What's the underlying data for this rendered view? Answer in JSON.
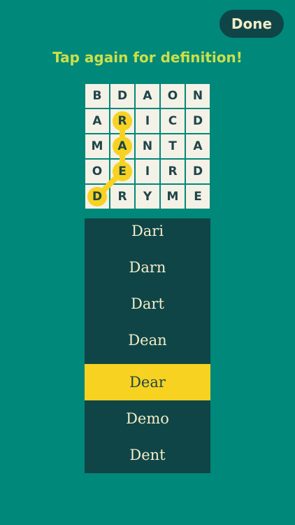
{
  "header": {
    "done_label": "Done",
    "instruction": "Tap again for definition!"
  },
  "colors": {
    "background": "#00887a",
    "dark": "#0f4547",
    "highlight": "#f7d221",
    "instruction_text": "#cbe049",
    "cell_bg": "#f4f1e6"
  },
  "grid": {
    "rows": [
      [
        "B",
        "D",
        "A",
        "O",
        "N"
      ],
      [
        "A",
        "R",
        "I",
        "C",
        "D"
      ],
      [
        "M",
        "A",
        "N",
        "T",
        "A"
      ],
      [
        "O",
        "E",
        "I",
        "R",
        "D"
      ],
      [
        "D",
        "R",
        "Y",
        "M",
        "E"
      ]
    ],
    "selected_path": [
      {
        "row": 1,
        "col": 1
      },
      {
        "row": 2,
        "col": 1
      },
      {
        "row": 3,
        "col": 1
      },
      {
        "row": 4,
        "col": 0
      }
    ]
  },
  "word_list": {
    "words": [
      "Dari",
      "Darn",
      "Dart",
      "Dean",
      "Dear",
      "Demo",
      "Dent"
    ],
    "selected_index": 4
  }
}
